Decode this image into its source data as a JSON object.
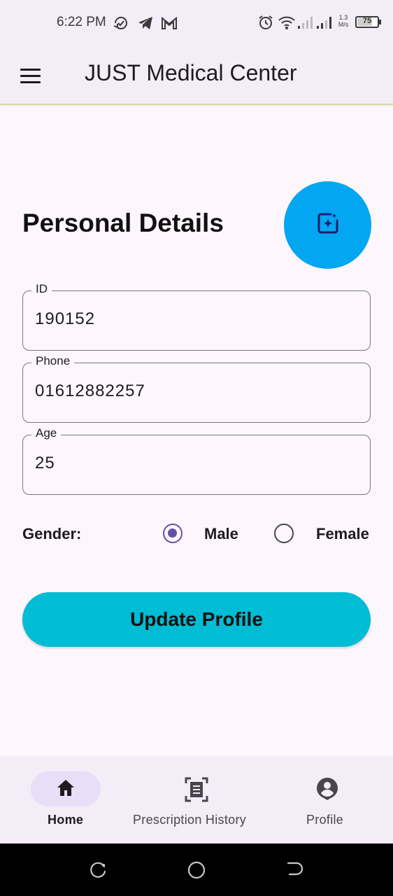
{
  "status_bar": {
    "time": "6:22 PM",
    "network_speed_value": "1.3",
    "network_speed_unit": "M/s",
    "battery_level": "75",
    "battery_percent": 75,
    "icons": [
      "sync-check-icon",
      "telegram-icon",
      "gmail-icon",
      "alarm-icon",
      "wifi-icon",
      "signal-icon",
      "signal-icon-2",
      "battery-icon"
    ]
  },
  "app_bar": {
    "title": "JUST Medical Center",
    "menu_icon": "menu-icon"
  },
  "main": {
    "section_title": "Personal Details",
    "fab_icon": "edit-image-icon",
    "fields": {
      "id": {
        "label": "ID",
        "value": "190152"
      },
      "phone": {
        "label": "Phone",
        "value": "01612882257"
      },
      "age": {
        "label": "Age",
        "value": "25"
      }
    },
    "gender": {
      "label": "Gender:",
      "options": [
        {
          "label": "Male",
          "selected": true
        },
        {
          "label": "Female",
          "selected": false
        }
      ]
    },
    "update_button": "Update Profile"
  },
  "bottom_nav": {
    "items": [
      {
        "label": "Home",
        "icon": "home-icon",
        "active": true
      },
      {
        "label": "Prescription History",
        "icon": "document-scan-icon",
        "active": false
      },
      {
        "label": "Profile",
        "icon": "account-icon",
        "active": false
      }
    ]
  },
  "system_nav": {
    "buttons": [
      "recents-icon",
      "home-circle-icon",
      "back-icon"
    ]
  },
  "colors": {
    "background": "#fdf7fd",
    "bar_surface": "#f2edf6",
    "fab": "#03a6f1",
    "primary_button": "#00bcd4",
    "radio_selected": "#6750a4",
    "nav_pill": "#e8def8"
  }
}
